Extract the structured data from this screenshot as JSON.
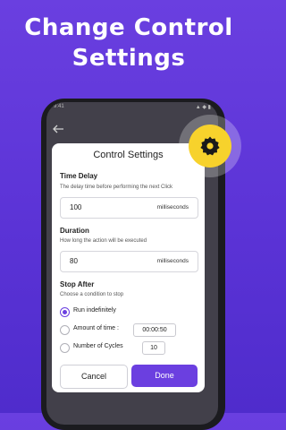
{
  "headline": {
    "line1": "Change Control",
    "line2": "Settings"
  },
  "status_bar": {
    "time": "9:41",
    "icons": "▲ ◆ ▮"
  },
  "back_icon": "arrow-left-icon",
  "gear_icon": "gear-icon",
  "dialog": {
    "title": "Control Settings",
    "time_delay": {
      "title": "Time Delay",
      "description": "The delay time before performing the next Click",
      "value": "100",
      "unit": "milliseconds"
    },
    "duration": {
      "title": "Duration",
      "description": "How long the action will be executed",
      "value": "80",
      "unit": "milliseconds"
    },
    "stop_after": {
      "title": "Stop After",
      "description": "Choose a condition to stop",
      "options": [
        {
          "label": "Run indefinitely",
          "selected": true
        },
        {
          "label": "Amount of time :",
          "selected": false,
          "value": "00:00:50"
        },
        {
          "label": "Number of Cycles",
          "selected": false,
          "value": "10"
        }
      ]
    },
    "cancel_label": "Cancel",
    "done_label": "Done"
  },
  "colors": {
    "accent": "#6b3fe0",
    "gear_bg": "#f7d22c",
    "background": "#5b33d6"
  }
}
